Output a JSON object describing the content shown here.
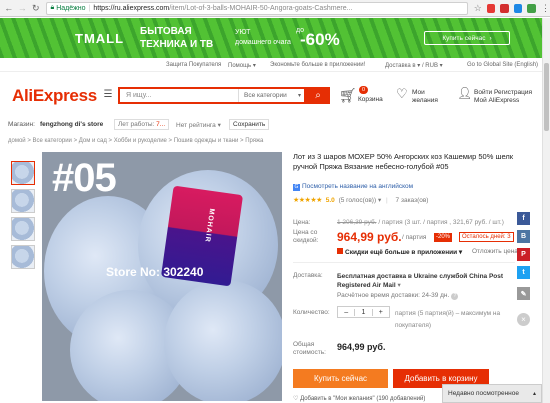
{
  "browser": {
    "secure_label": "Надёжно",
    "url_host": "https://ru.aliexpress.com",
    "url_path": "/item/Lot-of-3-balls-MOHAIR-50-Angora-goats-Cashmere..."
  },
  "banner": {
    "brand": "TMALL",
    "headline1": "БЫТОВАЯ",
    "headline2": "ТЕХНИКА И ТВ",
    "subline1": "УЮТ",
    "subline2": "домашнего очага",
    "prefix": "до",
    "discount": "-60%",
    "button": "Купить сейчас",
    "button_arrow": "›"
  },
  "toplinks": {
    "protection": "Защита Покупателя",
    "help": "Помощь ▾",
    "app": "Экономьте больше в приложении!",
    "delivery": "Доставка в ▾ / RUB ▾",
    "global": "Go to Global Site (English)"
  },
  "header": {
    "logo": "AliExpress",
    "search_placeholder": "Я ищу...",
    "search_category": "Все категории",
    "cart_count": "0",
    "cart_label": "Корзина",
    "wish_line1": "Мои",
    "wish_line2": "желания",
    "user_line1": "Войти  Регистрация",
    "user_line2": "Мой AliExpress"
  },
  "store": {
    "label": "Магазин:",
    "name": "fengzhong di's store",
    "years_label": "Лет работы:",
    "years_value": "7...",
    "rating_label": "Нет рейтинга ▾",
    "save_button": "Сохранить"
  },
  "breadcrumb": "домой  >  Все категории  >  Дом и сад  >  Хобби и рукоделие  >  Пошив одежды и ткани  >  Пряжа",
  "image": {
    "number": "#05",
    "watermark": "Store No: 302240",
    "label_text": "MOHAIR"
  },
  "product": {
    "title": "Лот из 3 шаров МОХЕР 50% Ангорских коз Кашемир 50% шелк ручной Пряжа Вязание небесно-голубой #05",
    "translate": "Посмотреть название на английском",
    "stars": "★★★★★",
    "score": "5.0",
    "reviews": "(5 голос(ов)) ▾",
    "orders": "7 заказ(ов)",
    "price_label": "Цена:",
    "old_price": "1 206,39 руб.",
    "old_price_suffix": "/ партия  (3 шт. / партия , 321,67 руб. / шт.)",
    "sale_label1": "Цена со",
    "sale_label2": "скидкой:",
    "sale_price": "964,99 руб.",
    "per_unit": "/ партия",
    "discount": "-20%",
    "time_left": "Осталось дней: 3",
    "coupons": "Скидки ещё больше в приложении ▾",
    "notify": "Отложить цена",
    "shipping_label": "Доставка:",
    "shipping_text": "Бесплатная доставка в Ukraine службой China Post Registered Air Mail",
    "eta": "Расчётное время доставки: 24-39 дн.",
    "qty_label": "Количество:",
    "qty_minus": "–",
    "qty_value": "1",
    "qty_plus": "+",
    "qty_info": "партия (5 партия(й) – максимум на покупателя)",
    "total_label1": "Общая",
    "total_label2": "стоимость:",
    "total": "964,99 руб.",
    "buy_button": "Купить сейчас",
    "cart_button": "Добавить в корзину",
    "wishlist": "Добавить в \"Мои желания\" (190 добавлений)"
  },
  "share": [
    {
      "icon": "facebook-icon",
      "glyph": "f",
      "color": "#3b5998"
    },
    {
      "icon": "vk-icon",
      "glyph": "B",
      "color": "#4c75a3"
    },
    {
      "icon": "pinterest-icon",
      "glyph": "P",
      "color": "#cb2027"
    },
    {
      "icon": "twitter-icon",
      "glyph": "t",
      "color": "#1da1f2"
    },
    {
      "icon": "edit-icon",
      "glyph": "✎",
      "color": "#999999"
    }
  ],
  "recent": {
    "label": "Недавно посмотренное",
    "caret": "▴"
  },
  "colors": {
    "brand": "#e62e04",
    "buy_now": "#f47b20",
    "banner": "#52c234"
  }
}
